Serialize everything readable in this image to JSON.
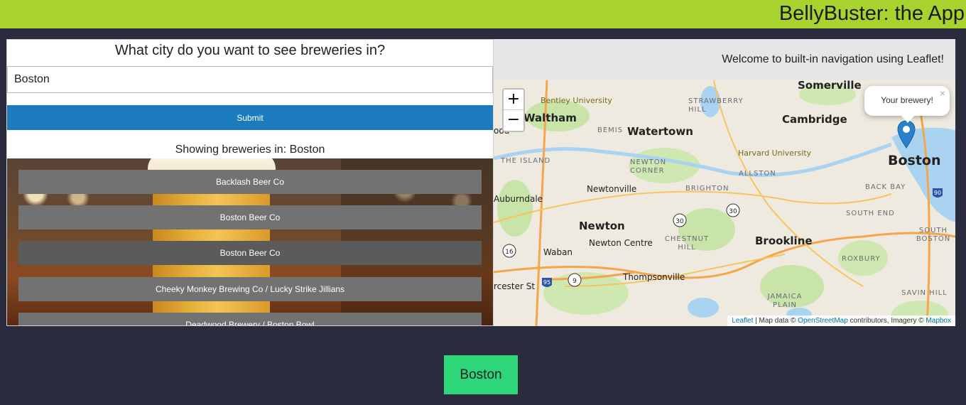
{
  "header": {
    "title": "BellyBuster: the App"
  },
  "search": {
    "question": "What city do you want to see breweries in?",
    "city_value": "Boston",
    "submit_label": "Submit"
  },
  "results": {
    "showing_text": "Showing breweries in: Boston",
    "breweries": [
      "Backlash Beer Co",
      "Boston Beer Co",
      "Boston Beer Co",
      "Cheeky Monkey Brewing Co / Lucky Strike Jillians",
      "Deadwood Brewery / Boston Bowl"
    ]
  },
  "map": {
    "welcome": "Welcome to built-in navigation using Leaflet!",
    "zoom_in": "+",
    "zoom_out": "−",
    "popup_text": "Your brewery!",
    "popup_close": "×",
    "attribution": {
      "leaflet": "Leaflet",
      "sep1": " | Map data © ",
      "osm": "OpenStreetMap",
      "sep2": " contributors, Imagery © ",
      "mapbox": "Mapbox"
    },
    "labels": {
      "somerville": "Somerville",
      "bentley": "Bentley University",
      "waltham": "Waltham",
      "strawberry_hill": "STRAWBERRY HILL",
      "cambridge": "Cambridge",
      "bemis": "BEMIS",
      "watertown": "Watertown",
      "ood": "ood",
      "harvard": "Harvard University",
      "the_island": "THE ISLAND",
      "newton_corner": "NEWTON CORNER",
      "allston": "ALLSTON",
      "boston": "Boston",
      "newtonville": "Newtonville",
      "brighton": "BRIGHTON",
      "back_bay": "BACK BAY",
      "auburndale": "Auburndale",
      "south_end": "SOUTH END",
      "newton": "Newton",
      "chestnut_hill": "CHESTNUT HILL",
      "brookline": "Brookline",
      "south_boston": "SOUTH BOSTON",
      "newton_centre": "Newton Centre",
      "waban": "Waban",
      "roxbury": "ROXBURY",
      "thompsonville": "Thompsonville",
      "worcester_st": "rcester St",
      "jamaica_plain": "JAMAICA PLAIN",
      "savin_hill": "SAVIN HILL"
    },
    "shields": {
      "r16": "16",
      "r30a": "30",
      "r30b": "30",
      "r9": "9",
      "i95": "95",
      "i90": "90"
    }
  },
  "footer": {
    "city_button": "Boston"
  }
}
